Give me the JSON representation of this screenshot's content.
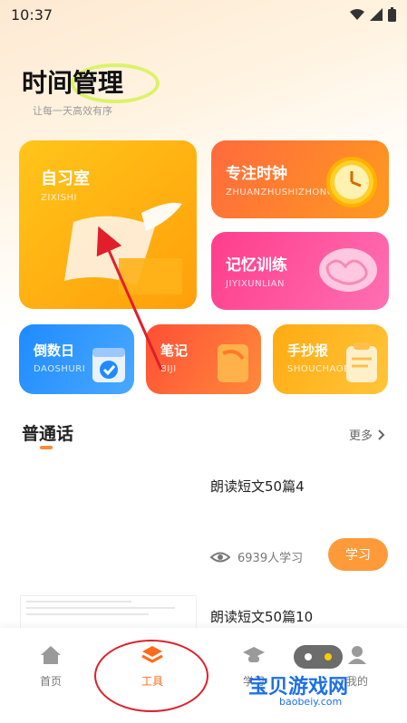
{
  "status": {
    "time": "10:37"
  },
  "header": {
    "title": "时间管理",
    "subtitle": "让每一天高效有序"
  },
  "tools": [
    {
      "title": "自习室",
      "pinyin": "ZIXISHI"
    },
    {
      "title": "专注时钟",
      "pinyin": "ZHUANZHUSHIZHONG"
    },
    {
      "title": "记忆训练",
      "pinyin": "JIYIXUNLIAN"
    },
    {
      "title": "倒数日",
      "pinyin": "DAOSHURI"
    },
    {
      "title": "笔记",
      "pinyin": "BIJI"
    },
    {
      "title": "手抄报",
      "pinyin": "SHOUCHAOBAO"
    }
  ],
  "section": {
    "title": "普通话",
    "more": "更多"
  },
  "items": [
    {
      "title": "朗读短文50篇4",
      "views": "6939人学习",
      "action": "学习"
    },
    {
      "title": "朗读短文50篇10"
    }
  ],
  "tabs": [
    {
      "label": "首页"
    },
    {
      "label": "工具"
    },
    {
      "label": "学习"
    },
    {
      "label": "我的"
    }
  ],
  "watermark": {
    "text": "宝贝游戏网",
    "domain": "baobeiy.com"
  },
  "colors": {
    "accent": "#ff9a3a",
    "active_tab": "#ff6a1a",
    "annotation": "#e01f2b"
  }
}
